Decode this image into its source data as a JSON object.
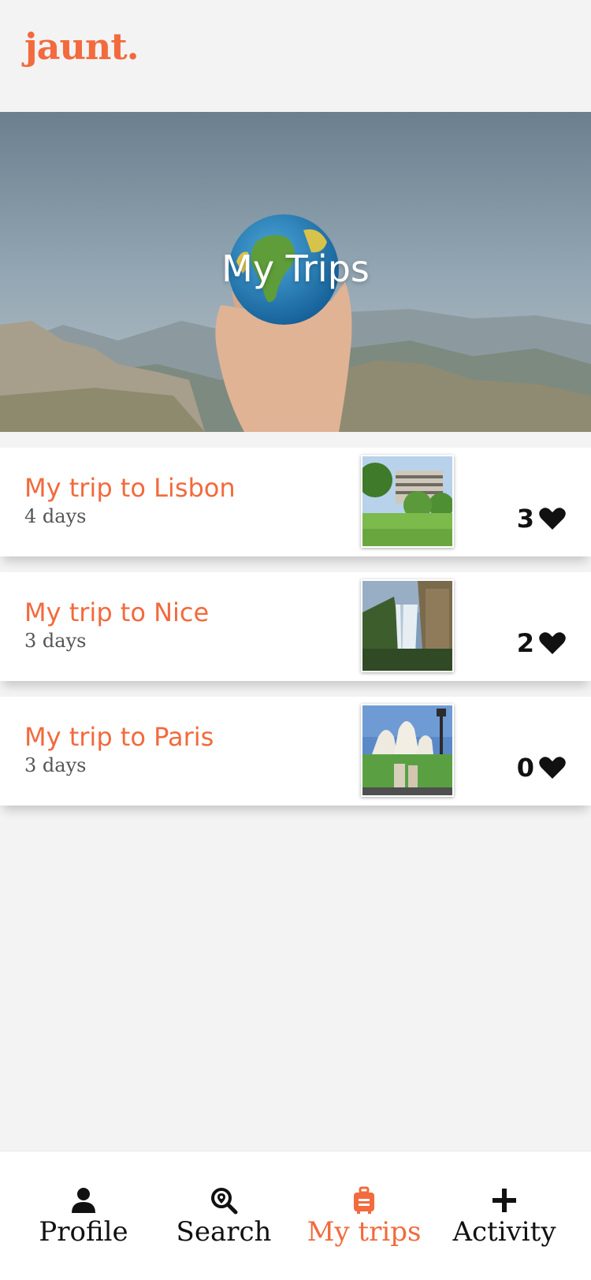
{
  "app": {
    "logo_text": "jaunt.",
    "accent_color": "#f26a3d"
  },
  "hero": {
    "title": "My Trips",
    "image": "globe-in-hand-over-mountains"
  },
  "trips": [
    {
      "title": "My trip to Lisbon",
      "days": "4 days",
      "likes": "3",
      "thumb": "lisbon-park-building"
    },
    {
      "title": "My trip to Nice",
      "days": "3 days",
      "likes": "2",
      "thumb": "nice-waterfall"
    },
    {
      "title": "My trip to Paris",
      "days": "3 days",
      "likes": "0",
      "thumb": "paris-sacre-coeur"
    }
  ],
  "icons": {
    "likes": "heart-icon",
    "profile": "person-icon",
    "search": "location-search-icon",
    "my_trips": "suitcase-icon",
    "activity": "plus-icon"
  },
  "nav": {
    "items": [
      {
        "label": "Profile",
        "icon": "person-icon",
        "active": false
      },
      {
        "label": "Search",
        "icon": "location-search-icon",
        "active": false
      },
      {
        "label": "My trips",
        "icon": "suitcase-icon",
        "active": true
      },
      {
        "label": "Activity",
        "icon": "plus-icon",
        "active": false
      }
    ],
    "active_color": "#f26a3d",
    "inactive_color": "#111111"
  }
}
